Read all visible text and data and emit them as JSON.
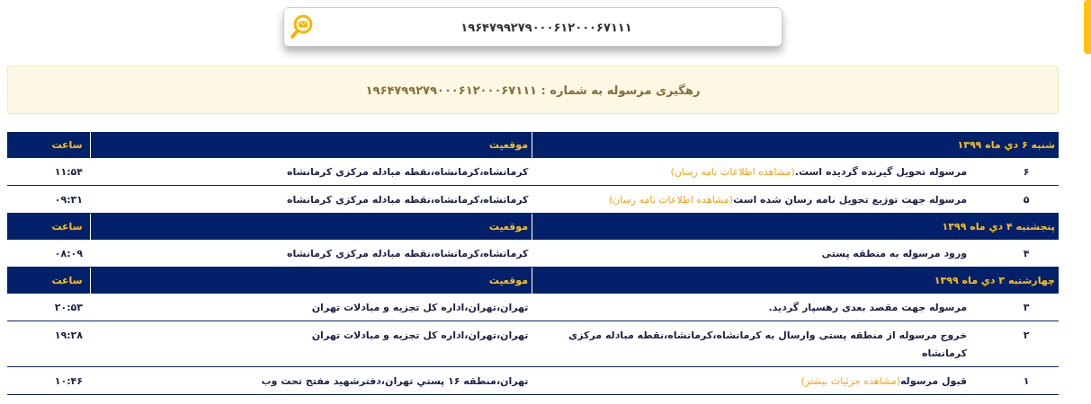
{
  "search": {
    "value": "۱۹۶۴۷۹۹۲۷۹۰۰۰۶۱۲۰۰۰۶۷۱۱۱"
  },
  "banner": {
    "text": "رهگیری مرسوله به شماره : ۱۹۶۴۷۹۹۲۷۹۰۰۰۶۱۲۰۰۰۶۷۱۱۱"
  },
  "groups": [
    {
      "date": "شنبه ۶ دي ماه ۱۳۹۹",
      "location_header": "موقعیت",
      "time_header": "ساعت",
      "events": [
        {
          "number": "۶",
          "description": "مرسوله تحویل گیرنده گردیده است.",
          "link": "(مشاهده اطلاعات نامه رسان)",
          "location": "کرمانشاه،کرمانشاه،نقطه مبادله مرکزی کرمانشاه",
          "time": "۱۱:۵۴"
        },
        {
          "number": "۵",
          "description": "مرسوله جهت توزیع تحویل نامه رسان شده است",
          "link": "(مشاهده اطلاعات نامه رسان)",
          "location": "کرمانشاه،کرمانشاه،نقطه مبادله مرکزی کرمانشاه",
          "time": "۰۹:۳۱"
        }
      ]
    },
    {
      "date": "پنجشنبه ۴ دي ماه ۱۳۹۹",
      "location_header": "موقعیت",
      "time_header": "ساعت",
      "events": [
        {
          "number": "۴",
          "description": "ورود مرسوله به منطقه پستی",
          "location": "کرمانشاه،کرمانشاه،نقطه مبادله مرکزی کرمانشاه",
          "time": "۰۸:۰۹"
        }
      ]
    },
    {
      "date": "چهارشنبه ۳ دي ماه ۱۳۹۹",
      "location_header": "موقعیت",
      "time_header": "ساعت",
      "events": [
        {
          "number": "۳",
          "description": "مرسوله جهت مقصد بعدی رهسپار گردید.",
          "location": "تهران،تهران،اداره کل تجزیه و مبادلات تهران",
          "time": "۲۰:۵۳"
        },
        {
          "number": "۲",
          "description": "خروج مرسوله از منطقه پستی وارسال به کرمانشاه،کرمانشاه،نقطه مبادله مرکزی کرمانشاه",
          "location": "تهران،تهران،اداره کل تجزیه و مبادلات تهران",
          "time": "۱۹:۲۸"
        },
        {
          "number": "۱",
          "description": "قبول مرسوله",
          "link": "(مشاهده جزئیات بیشتر)",
          "location": "تهران،منطقه ۱۶ پستي تهران،دفترشهید مفتح تحت وب",
          "time": "۱۰:۴۶"
        }
      ]
    }
  ]
}
